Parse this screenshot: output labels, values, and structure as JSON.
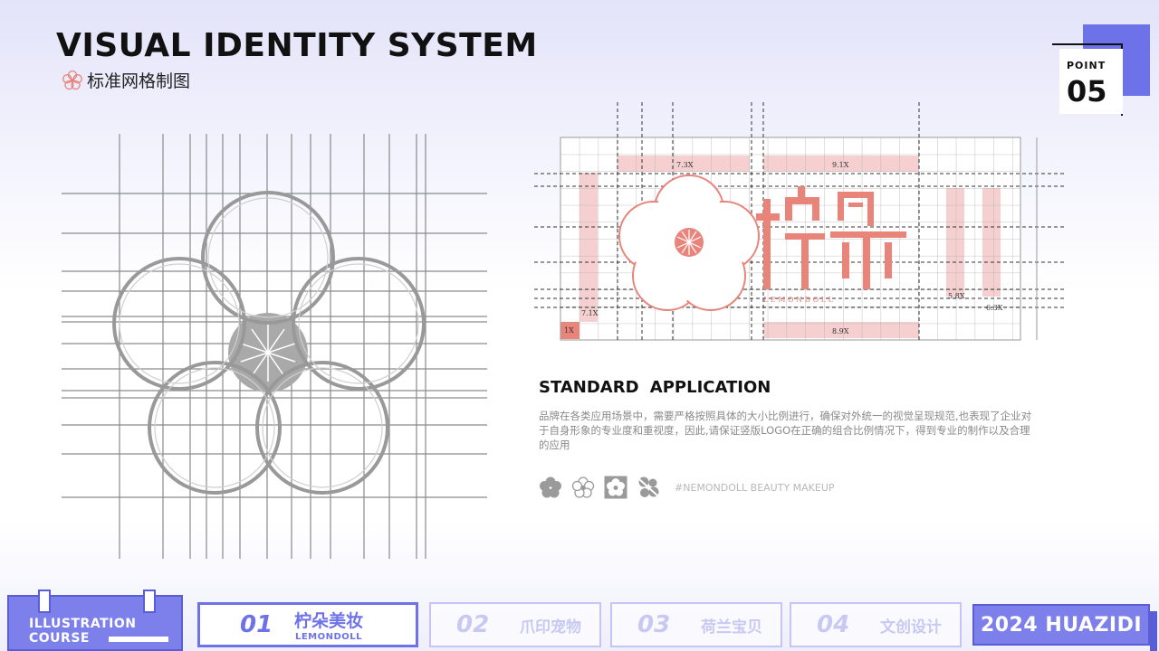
{
  "header": {
    "title": "VISUAL IDENTITY SYSTEM",
    "subtitle": "标准网格制图",
    "point_label": "POINT",
    "point_number": "05"
  },
  "logo_grid": {
    "labels": [
      "7.3X",
      "9.1X",
      "7.1X",
      "1X",
      "8.9X",
      "5.8X",
      "6.3X"
    ]
  },
  "standard": {
    "title": "STANDARD   APPLICATION",
    "description": "品牌在各类应用场景中，需要严格按照具体的大小比例进行，确保对外统一的视觉呈现规范,也表现了企业对于自身形象的专业度和重视度，因此,请保证竖版LOGO在正确的组合比例情况下，得到专业的制作以及合理的应用",
    "hashtag": "#NEMONDOLL BEAUTY MAKEUP"
  },
  "footer": {
    "course_line1": "ILLUSTRATION",
    "course_line2": "COURSE",
    "nav": [
      {
        "num": "01",
        "label": "柠朵美妆",
        "sub": "LEMONDOLL",
        "active": true
      },
      {
        "num": "02",
        "label": "爪印宠物"
      },
      {
        "num": "03",
        "label": "荷兰宝贝"
      },
      {
        "num": "04",
        "label": "文创设计"
      }
    ],
    "brand_year": "2024 HUAZIDI"
  },
  "colors": {
    "accent": "#6e72e8",
    "logo_coral": "#e8847a",
    "grid_gray": "#9a9a9a",
    "pink_band": "#f6d0d0"
  },
  "icons": [
    "flower-solid-icon",
    "flower-outline-icon",
    "flower-box-icon",
    "flower-dotted-icon",
    "flower-logo-icon"
  ]
}
